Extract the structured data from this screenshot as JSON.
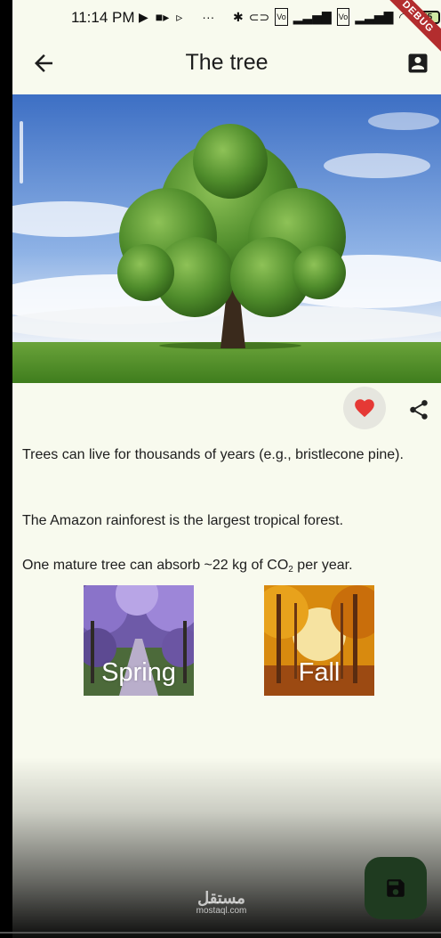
{
  "status_bar": {
    "time": "11:14 PM",
    "icons": [
      "play-icon",
      "video-icon",
      "cast-icon",
      "more-dots-icon",
      "bluetooth-icon",
      "key-icon",
      "volte-icon",
      "signal-icon",
      "volte-icon",
      "signal-icon",
      "wifi-icon"
    ],
    "battery": "55",
    "debug_label": "DEBUG"
  },
  "app_bar": {
    "title": "The tree",
    "back_icon": "arrow-back-icon",
    "profile_icon": "account-box-icon"
  },
  "actions": {
    "favorite_icon": "heart-icon",
    "share_icon": "share-icon"
  },
  "facts": [
    "Trees can live for thousands of years (e.g., bristlecone pine).",
    "The Amazon rainforest is the largest tropical forest.",
    {
      "before": "One mature tree can absorb ~22 kg of CO",
      "subscript": "2",
      "after": " per year."
    }
  ],
  "seasons": [
    {
      "label": "Spring"
    },
    {
      "label": "Fall"
    }
  ],
  "watermark": {
    "logo": "مستقل",
    "site": "mostaql.com"
  },
  "fab_icon": "save-icon",
  "colors": {
    "background": "#f8faee",
    "favorite": "#e53935",
    "fab": "#1f3b20"
  }
}
